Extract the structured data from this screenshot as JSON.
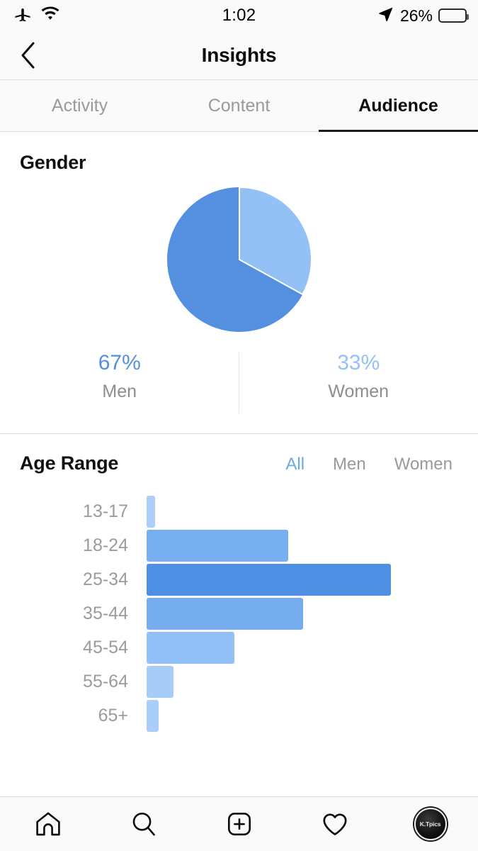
{
  "status_bar": {
    "airplane_icon": "airplane-icon",
    "wifi_icon": "wifi-icon",
    "time": "1:02",
    "location_icon": "location-arrow-icon",
    "battery_percent": "26%",
    "battery_level": 26
  },
  "nav_header": {
    "back_icon": "chevron-left-icon",
    "title": "Insights"
  },
  "tabs": [
    {
      "label": "Activity",
      "active": false
    },
    {
      "label": "Content",
      "active": false
    },
    {
      "label": "Audience",
      "active": true
    }
  ],
  "gender_section": {
    "title": "Gender",
    "legend": [
      {
        "percent": "67%",
        "label": "Men",
        "color": "#5590e0"
      },
      {
        "percent": "33%",
        "label": "Women",
        "color": "#94c1f5"
      }
    ]
  },
  "age_section": {
    "title": "Age Range",
    "filters": [
      {
        "label": "All",
        "active": true
      },
      {
        "label": "Men",
        "active": false
      },
      {
        "label": "Women",
        "active": false
      }
    ]
  },
  "bottom_nav": [
    {
      "icon": "home-icon",
      "label": "Home"
    },
    {
      "icon": "search-icon",
      "label": "Search"
    },
    {
      "icon": "add-post-icon",
      "label": "New Post"
    },
    {
      "icon": "heart-icon",
      "label": "Activity"
    },
    {
      "icon": "profile-avatar",
      "label": "K.Tpics"
    }
  ],
  "colors": {
    "accent_blue": "#4f8fe3",
    "light_blue": "#94c1f5",
    "lightest_blue": "#accff8",
    "text_gray": "#9a9a9a",
    "text_dark": "#101010",
    "chrome_bg": "#fafafa"
  },
  "chart_data": [
    {
      "type": "pie",
      "title": "Gender",
      "categories": [
        "Men",
        "Women"
      ],
      "values": [
        67,
        33
      ],
      "labels": [
        "67%",
        "33%"
      ],
      "colors": [
        "#5590e0",
        "#94c1f5"
      ],
      "start_angle_deg": 0,
      "direction": "clockwise",
      "legend": "below"
    },
    {
      "type": "bar",
      "orientation": "horizontal",
      "title": "Age Range",
      "xlabel": "",
      "ylabel": "",
      "grid": false,
      "legend": "none",
      "active_filter": "All",
      "categories": [
        "13-17",
        "18-24",
        "25-34",
        "35-44",
        "45-54",
        "55-64",
        "65+"
      ],
      "values": [
        3,
        58,
        100,
        64,
        36,
        11,
        5
      ],
      "value_unit": "percent-of-max",
      "xlim": [
        0,
        100
      ],
      "colors": [
        "#accff8",
        "#78aff0",
        "#4f8fe3",
        "#76adef",
        "#93c0f6",
        "#a8ccf8",
        "#abcef8"
      ]
    }
  ]
}
